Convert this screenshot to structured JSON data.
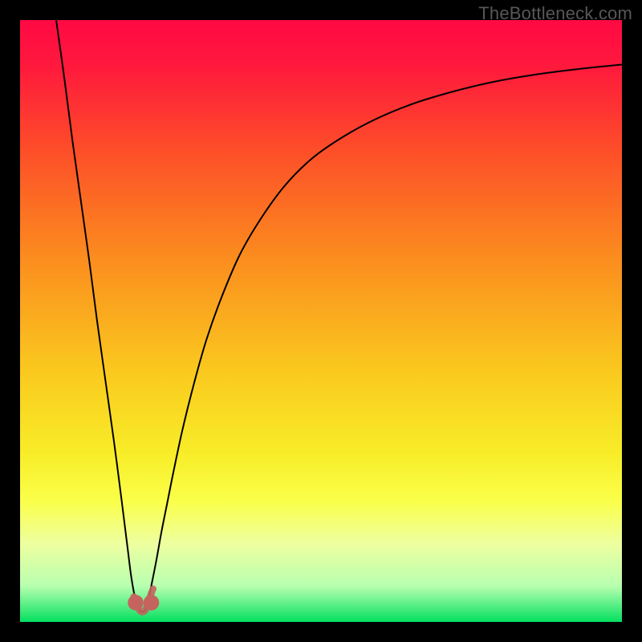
{
  "watermark": "TheBottleneck.com",
  "chart_data": {
    "type": "line",
    "title": "",
    "xlabel": "",
    "ylabel": "",
    "xlim": [
      0,
      100
    ],
    "ylim": [
      0,
      100
    ],
    "background_gradient": {
      "stops": [
        {
          "pos": 0.0,
          "color": "#ff0944"
        },
        {
          "pos": 0.08,
          "color": "#ff1a3c"
        },
        {
          "pos": 0.22,
          "color": "#fd4f28"
        },
        {
          "pos": 0.4,
          "color": "#fb8e1e"
        },
        {
          "pos": 0.58,
          "color": "#fac81e"
        },
        {
          "pos": 0.72,
          "color": "#f8ed28"
        },
        {
          "pos": 0.8,
          "color": "#faff4a"
        },
        {
          "pos": 0.87,
          "color": "#eeffa0"
        },
        {
          "pos": 0.94,
          "color": "#b8ffb0"
        },
        {
          "pos": 1.0,
          "color": "#04e060"
        }
      ]
    },
    "series": [
      {
        "name": "bottleneck-curve",
        "stroke": "#000000",
        "stroke_width": 2,
        "x": [
          6.0,
          7.4,
          8.7,
          10.1,
          11.5,
          12.8,
          14.2,
          15.6,
          16.9,
          17.9,
          18.4,
          18.9,
          19.4,
          19.8,
          20.15,
          20.5,
          20.85,
          21.2,
          21.6,
          22.6,
          23.5,
          24.5,
          25.5,
          27.0,
          29.0,
          31.0,
          33.5,
          36.5,
          40.0,
          44.0,
          48.5,
          53.5,
          59.0,
          65.0,
          71.5,
          78.5,
          86.0,
          94.0,
          100.0
        ],
        "y": [
          100.0,
          90.0,
          80.0,
          70.0,
          60.0,
          50.0,
          40.0,
          30.0,
          20.0,
          12.0,
          8.0,
          5.0,
          3.0,
          2.0,
          1.7,
          1.7,
          2.0,
          3.0,
          5.0,
          10.0,
          15.0,
          20.0,
          25.0,
          32.0,
          40.0,
          47.0,
          54.0,
          61.0,
          67.0,
          72.5,
          77.0,
          80.5,
          83.5,
          86.0,
          88.0,
          89.7,
          91.0,
          92.0,
          92.6
        ]
      }
    ],
    "markers": [
      {
        "name": "valley-left",
        "x": 19.2,
        "y": 3.2,
        "r": 1.3,
        "color": "#c5645f"
      },
      {
        "name": "valley-right",
        "x": 21.8,
        "y": 3.2,
        "r": 1.3,
        "color": "#c5645f"
      }
    ],
    "valley_stroke": {
      "color": "#c5645f",
      "width": 1.4,
      "x": [
        18.9,
        19.4,
        19.8,
        20.15,
        20.5,
        20.85,
        21.2,
        21.6,
        22.1
      ],
      "y": [
        4.2,
        3.0,
        2.0,
        1.7,
        1.7,
        2.0,
        3.0,
        4.2,
        5.5
      ]
    }
  }
}
